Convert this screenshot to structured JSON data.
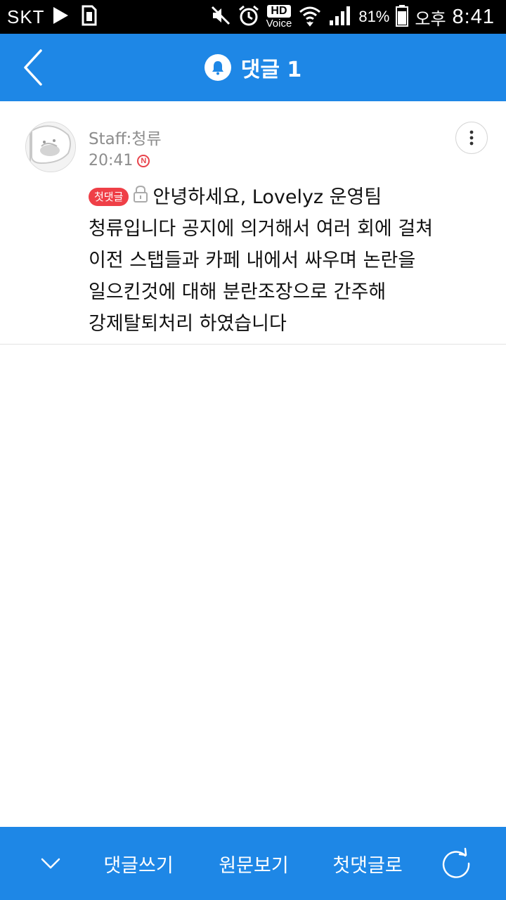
{
  "status_bar": {
    "carrier": "SKT",
    "battery": "81%",
    "ampm": "오후",
    "time": "8:41",
    "hd_label": "HD",
    "voice_label": "Voice",
    "icons": [
      "play-icon",
      "sim-icon",
      "mute-icon",
      "alarm-icon",
      "wifi-icon",
      "signal-icon",
      "battery-icon"
    ]
  },
  "header": {
    "title": "댓글 1",
    "accent": "#1e87e6"
  },
  "comment": {
    "author": "Staff:청류",
    "time": "20:41",
    "new_badge": "N",
    "first_badge": "첫댓글",
    "lines": [
      "안녕하세요, Lovelyz 운영팀",
      "청류입니다 공지에 의거해서 여러 회에 걸쳐",
      "이전 스탭들과 카페 내에서 싸우며 논란을",
      "일으킨것에 대해 분란조장으로 간주해",
      "강제탈퇴처리 하였습니다"
    ]
  },
  "bottom_bar": {
    "write_comment": "댓글쓰기",
    "view_original": "원문보기",
    "to_first_comment": "첫댓글로"
  }
}
